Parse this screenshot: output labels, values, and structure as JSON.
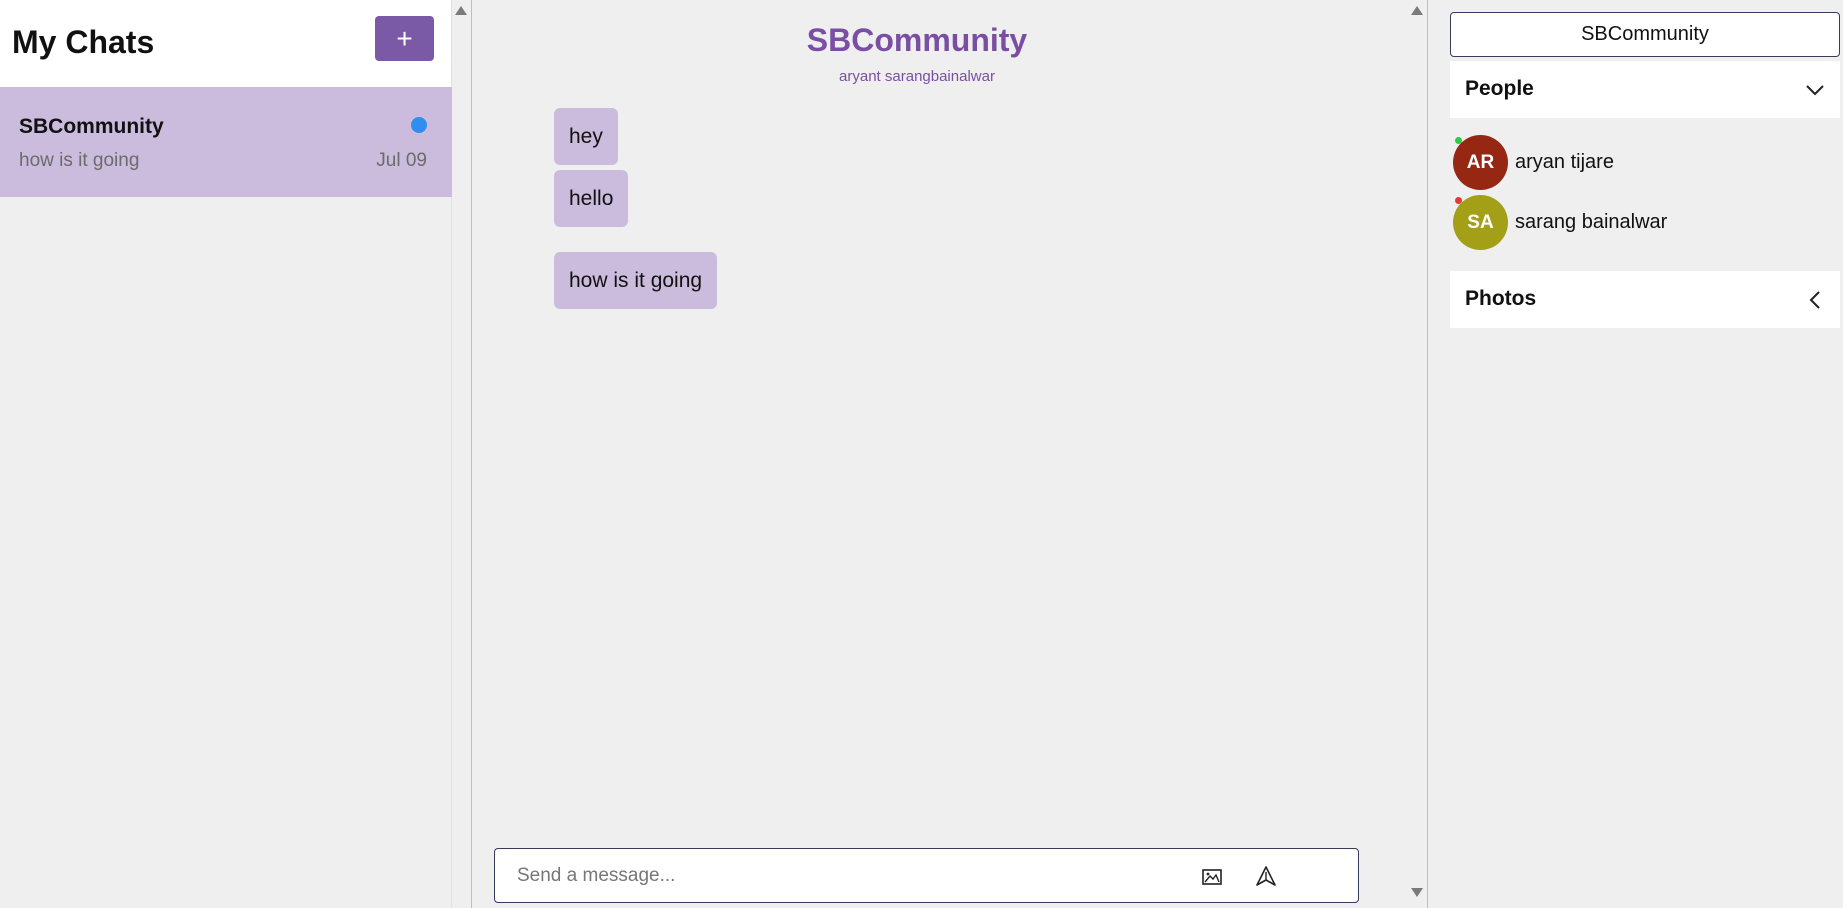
{
  "left_panel": {
    "title": "My Chats",
    "add_button_label": "+",
    "chats": [
      {
        "name": "SBCommunity",
        "preview": "how is it going",
        "date": "Jul 09",
        "unread": true
      }
    ]
  },
  "conversation": {
    "title": "SBCommunity",
    "subtitle": "aryant sarangbainalwar",
    "messages": [
      {
        "text": "hey"
      },
      {
        "text": "hello"
      },
      {
        "text": "how is it going"
      }
    ],
    "composer": {
      "placeholder": "Send a message...",
      "image_icon": "image-icon",
      "send_icon": "send-icon"
    }
  },
  "right_panel": {
    "room_button_label": "SBCommunity",
    "people_section": {
      "label": "People",
      "icon": "chevron-down-icon"
    },
    "people": [
      {
        "initials": "AR",
        "name": "aryan tijare",
        "avatar_color": "#962713",
        "status": "online",
        "status_color": "#2ecc40"
      },
      {
        "initials": "SA",
        "name": "sarang bainalwar",
        "avatar_color": "#a39f17",
        "status": "offline",
        "status_color": "#e53935"
      }
    ],
    "photos_section": {
      "label": "Photos",
      "icon": "chevron-left-icon"
    }
  },
  "colors": {
    "accent": "#7a5aa6",
    "bubble": "#cbbcdd",
    "title": "#7a4fa3",
    "unread": "#2f8ef0",
    "background": "#efefef"
  }
}
